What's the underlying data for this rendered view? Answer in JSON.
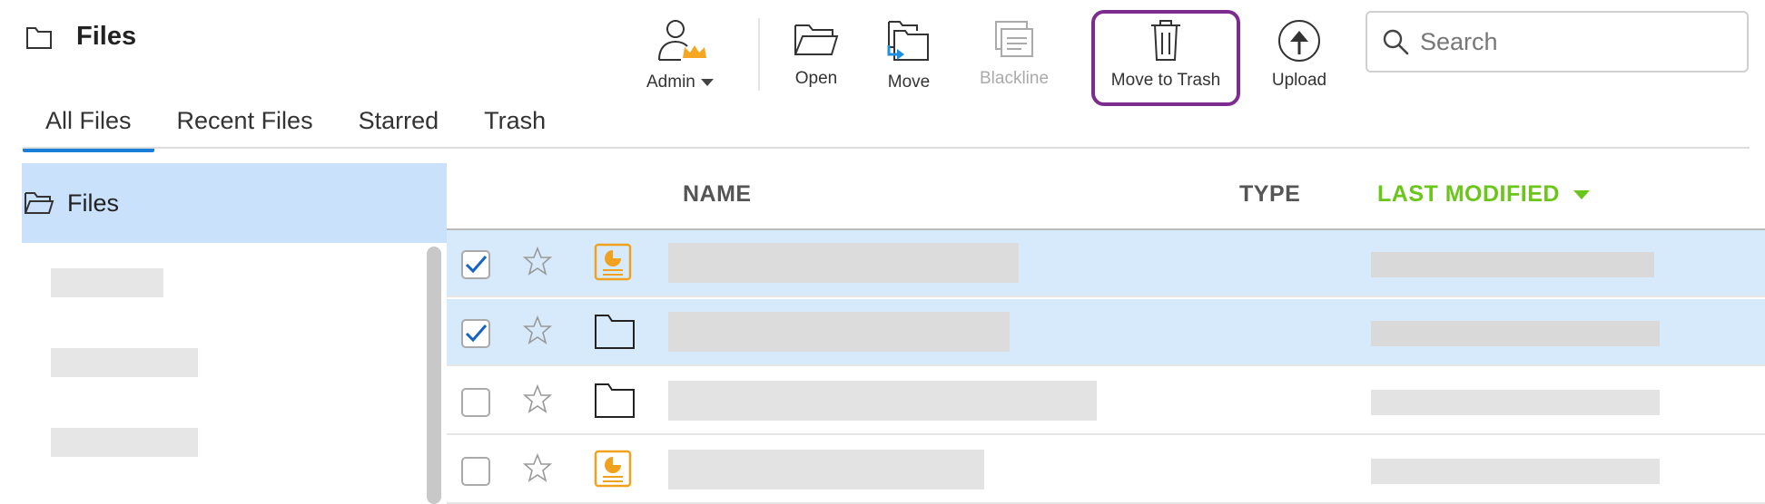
{
  "header": {
    "title": "Files",
    "toolbar": [
      {
        "id": "admin",
        "label": "Admin",
        "icon": "admin-user-crown-icon"
      },
      {
        "id": "open",
        "label": "Open",
        "icon": "folder-open-icon"
      },
      {
        "id": "move",
        "label": "Move",
        "icon": "folder-move-icon"
      },
      {
        "id": "blackline",
        "label": "Blackline",
        "icon": "blackline-compare-icon",
        "disabled": true
      },
      {
        "id": "trash",
        "label": "Move to Trash",
        "icon": "trash-icon",
        "highlighted": true
      },
      {
        "id": "upload",
        "label": "Upload",
        "icon": "upload-arrow-icon"
      }
    ],
    "search": {
      "placeholder": "Search",
      "value": ""
    }
  },
  "tabs": [
    {
      "label": "All Files",
      "active": true
    },
    {
      "label": "Recent Files",
      "active": false
    },
    {
      "label": "Starred",
      "active": false
    },
    {
      "label": "Trash",
      "active": false
    }
  ],
  "sidebar": {
    "root": {
      "label": "Files",
      "icon": "folder-open-icon",
      "selected": true
    }
  },
  "table": {
    "columns": {
      "name": "NAME",
      "type": "TYPE",
      "modified": "LAST MODIFIED"
    },
    "sort": {
      "column": "modified",
      "direction": "desc"
    },
    "rows": [
      {
        "checked": true,
        "starred": false,
        "icon": "presentation-file-icon",
        "selected": true
      },
      {
        "checked": true,
        "starred": false,
        "icon": "folder-icon",
        "selected": true
      },
      {
        "checked": false,
        "starred": false,
        "icon": "folder-icon",
        "selected": false
      },
      {
        "checked": false,
        "starred": false,
        "icon": "presentation-file-icon",
        "selected": false
      }
    ]
  },
  "colors": {
    "accent_tab": "#1a7fd8",
    "sort_header": "#6cc51b",
    "selection": "#d6eafc",
    "sidebar_selection": "#c9e1fb",
    "highlight_border": "#7b2c8e",
    "file_icon": "#f0a21e",
    "crown": "#f5a623",
    "move_arrow": "#1e90e0"
  }
}
